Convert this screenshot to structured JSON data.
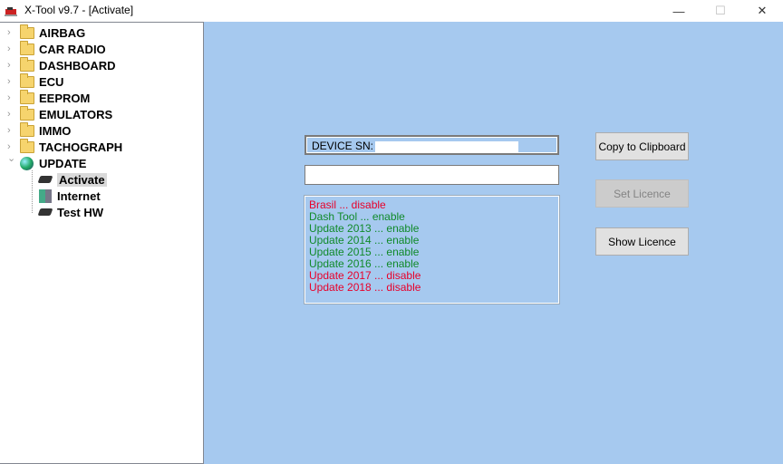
{
  "window": {
    "title": "X-Tool v9.7  -  [Activate]",
    "minimize": "—",
    "maximize": "☐",
    "close": "✕"
  },
  "tree": {
    "folders": [
      "AIRBAG",
      "CAR RADIO",
      "DASHBOARD",
      "ECU",
      "EEPROM",
      "EMULATORS",
      "IMMO",
      "TACHOGRAPH"
    ],
    "update": {
      "label": "UPDATE",
      "children": [
        "Activate",
        "Internet",
        "Test HW"
      ],
      "selected": "Activate"
    }
  },
  "main": {
    "device_sn_label": "DEVICE SN:",
    "licence_input_value": "",
    "status": [
      {
        "text": "Brasil ... disable",
        "state": "disable"
      },
      {
        "text": "Dash Tool ... enable",
        "state": "enable"
      },
      {
        "text": "Update 2013 ... enable",
        "state": "enable"
      },
      {
        "text": "Update 2014 ... enable",
        "state": "enable"
      },
      {
        "text": "Update 2015 ... enable",
        "state": "enable"
      },
      {
        "text": "Update 2016 ... enable",
        "state": "enable"
      },
      {
        "text": "Update 2017 ... disable",
        "state": "disable"
      },
      {
        "text": "Update 2018 ... disable",
        "state": "disable"
      }
    ],
    "buttons": {
      "copy": "Copy to Clipboard",
      "set": "Set Licence",
      "show": "Show Licence"
    }
  },
  "colors": {
    "panel": "#a6c9ef",
    "enable": "#108a2a",
    "disable": "#e8002a"
  }
}
